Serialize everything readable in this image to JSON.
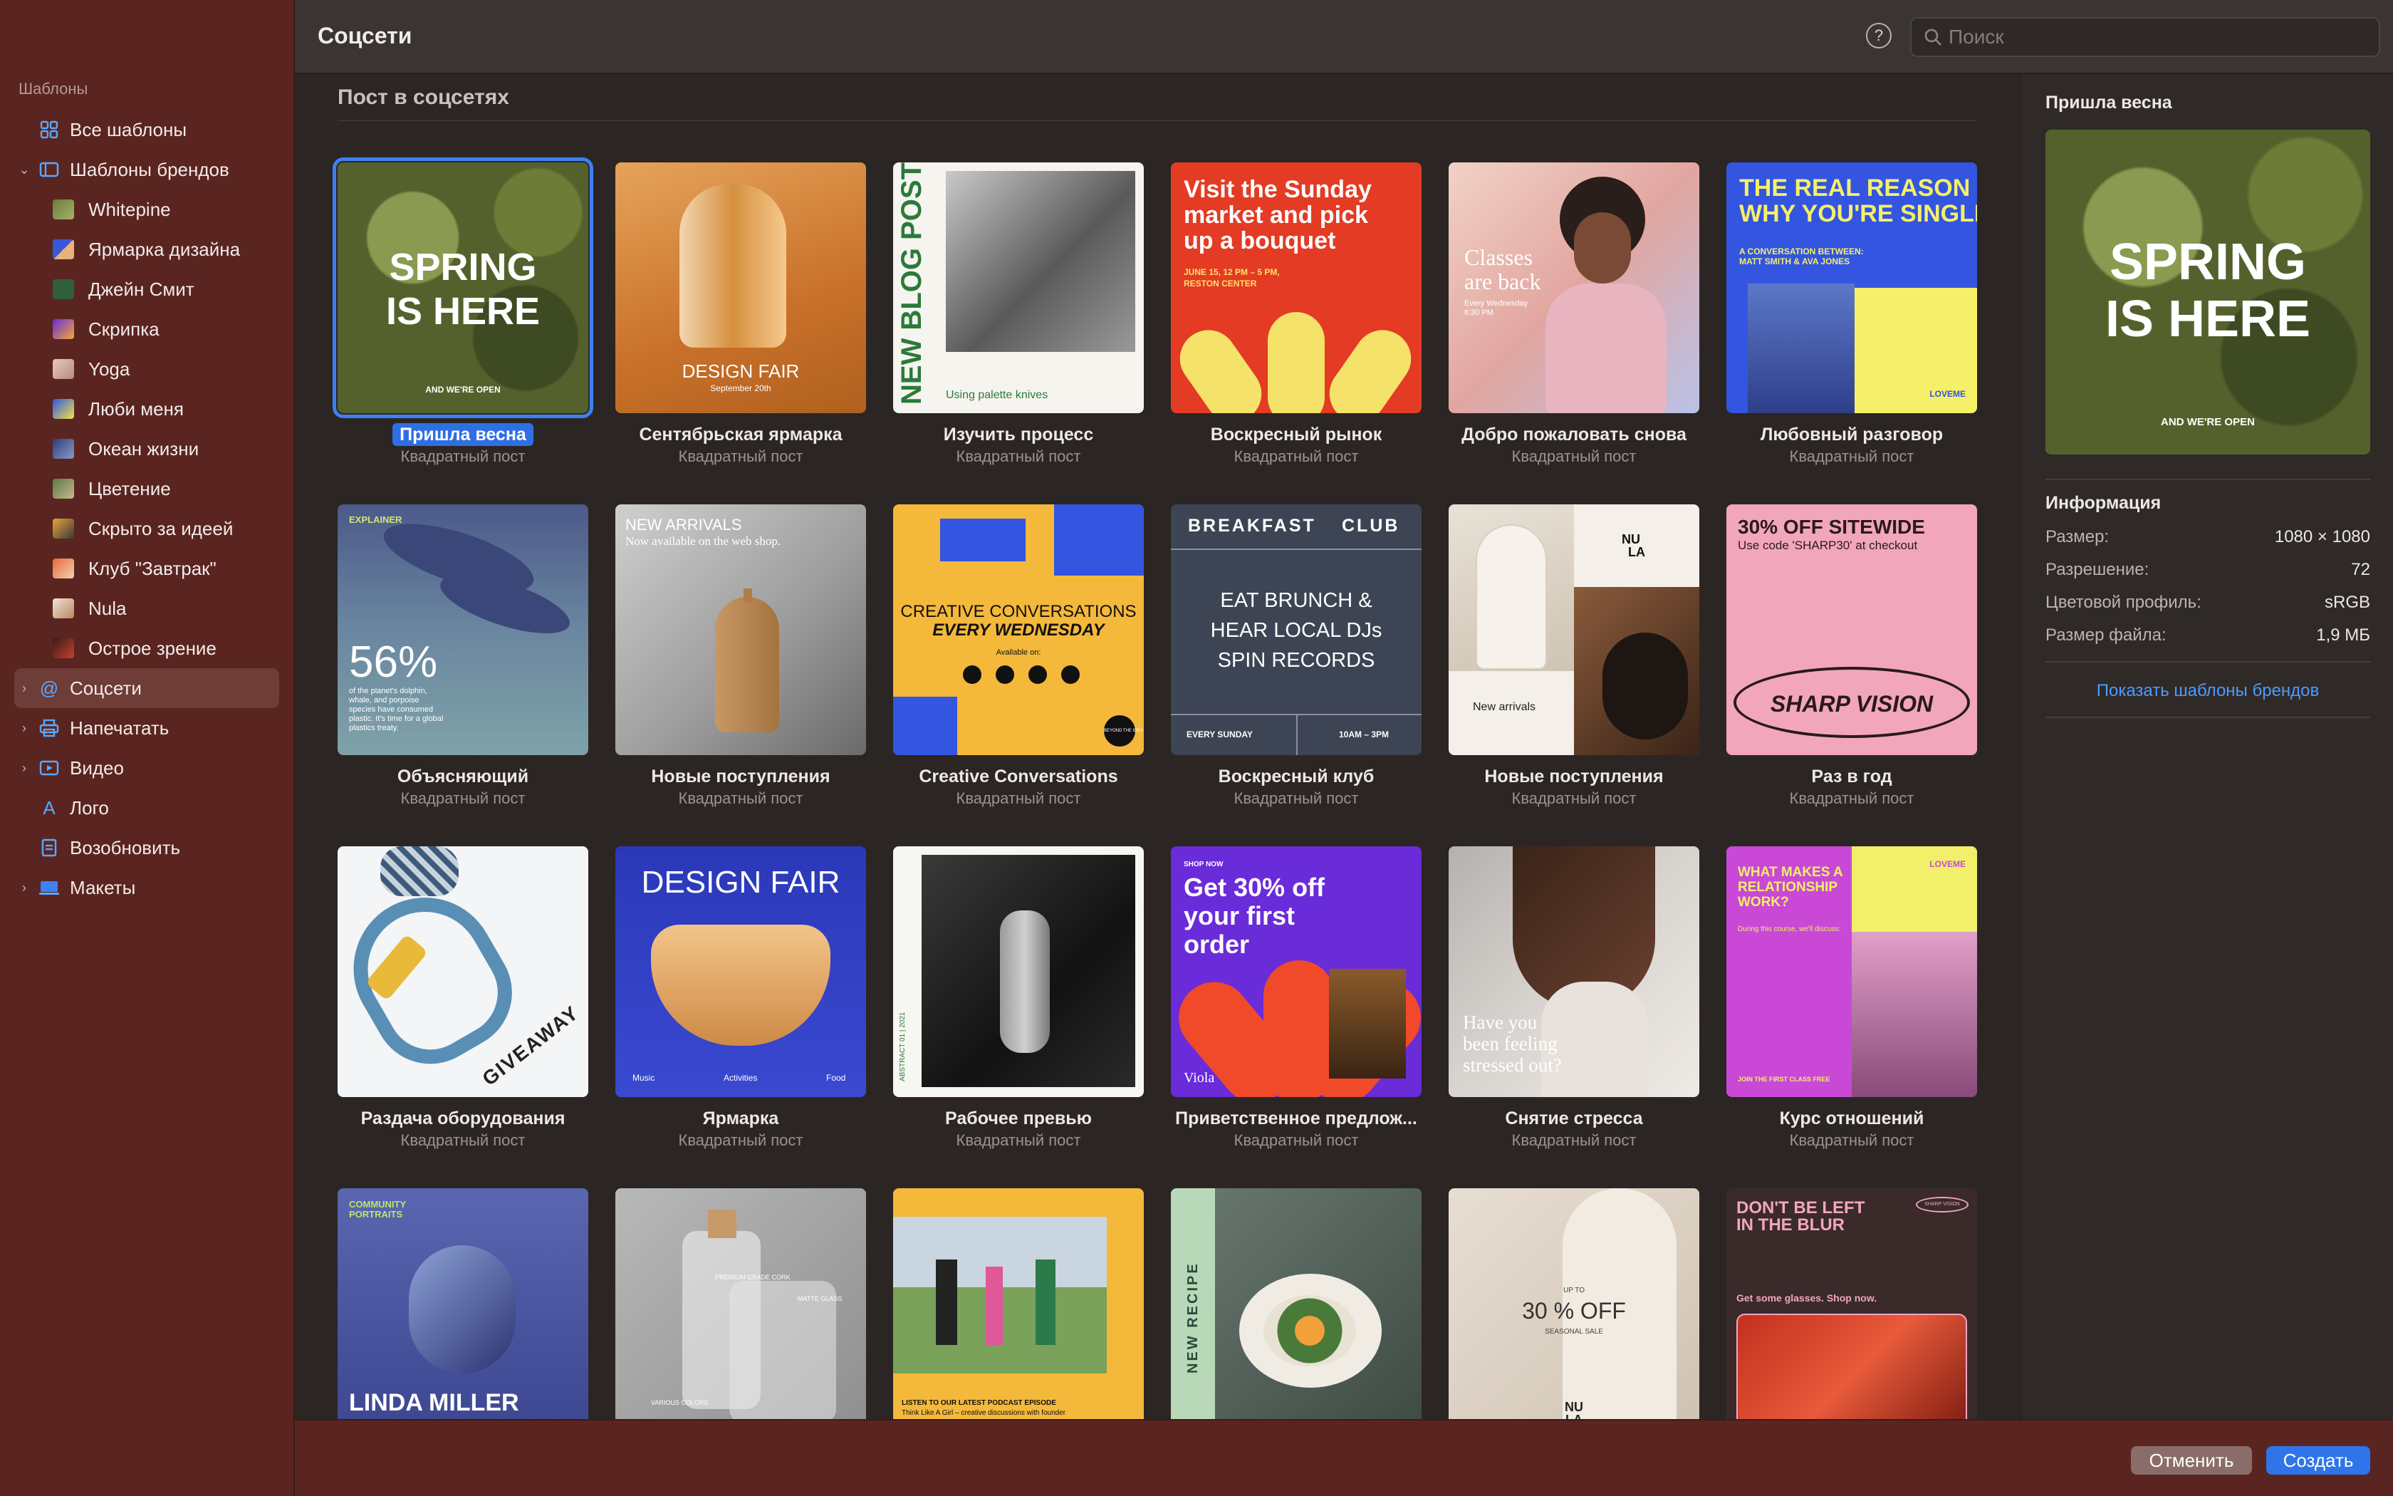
{
  "topbar": {
    "title": "Соцсети",
    "help": "?",
    "search_placeholder": "Поиск"
  },
  "sidebar": {
    "section": "Шаблоны",
    "all_templates": "Все шаблоны",
    "brand_templates": "Шаблоны брендов",
    "brands": [
      "Whitepine",
      "Ярмарка дизайна",
      "Джейн Смит",
      "Скрипка",
      "Yoga",
      "Люби меня",
      "Океан жизни",
      "Цветение",
      "Скрыто за идеей",
      "Клуб \"Завтрак\"",
      "Nula",
      "Острое зрение"
    ],
    "social": "Соцсети",
    "print": "Напечатать",
    "video": "Видео",
    "logo": "Лого",
    "resume": "Возобновить",
    "mockups": "Макеты"
  },
  "main": {
    "section_title": "Пост в соцсетях",
    "card_subtitle": "Квадратный пост",
    "cards": [
      {
        "title": "Пришла весна"
      },
      {
        "title": "Сентябрьская ярмарка"
      },
      {
        "title": "Изучить процесс"
      },
      {
        "title": "Воскресный рынок"
      },
      {
        "title": "Добро пожаловать снова"
      },
      {
        "title": "Любовный разговор"
      },
      {
        "title": "Объясняющий"
      },
      {
        "title": "Новые поступления"
      },
      {
        "title": "Creative Conversations"
      },
      {
        "title": "Воскресный клуб"
      },
      {
        "title": "Новые поступления"
      },
      {
        "title": "Раз в год"
      },
      {
        "title": "Раздача оборудования"
      },
      {
        "title": "Ярмарка"
      },
      {
        "title": "Рабочее превью"
      },
      {
        "title": "Приветственное предлож..."
      },
      {
        "title": "Снятие стресса"
      },
      {
        "title": "Курс отношений"
      }
    ],
    "thumbs": {
      "spring": [
        "SPRING",
        "IS HERE",
        "AND WE'RE OPEN"
      ],
      "fair": [
        "DESIGN FAIR",
        "September 20th"
      ],
      "blog": [
        "NEW BLOG POST",
        "Using palette knives"
      ],
      "market": [
        "Visit the Sunday",
        "market and pick",
        "up a bouquet",
        "JUNE 15, 12 PM – 5 PM,",
        "RESTON CENTER"
      ],
      "classes": [
        "Classes",
        "are back",
        "Every Wednesday",
        "6:30 PM"
      ],
      "reason": [
        "THE REAL REASON",
        "WHY YOU'RE SINGLE",
        "A CONVERSATION BETWEEN:",
        "MATT SMITH & AVA JONES",
        "LOVEME"
      ],
      "explainer": [
        "EXPLAINER",
        "56%",
        "of the planet's dolphin,",
        "whale, and porpoise",
        "species have consumed",
        "plastic. It's time for a global",
        "plastics treaty."
      ],
      "arrivals": [
        "NEW ARRIVALS",
        "Now available on the web shop."
      ],
      "creative": [
        "CREATIVE CONVERSATIONS",
        "EVERY WEDNESDAY",
        "Available on:",
        "BEYOND THE IDEA"
      ],
      "breakfast": [
        "BREAKFAST",
        "CLUB",
        "EAT BRUNCH &",
        "HEAR LOCAL DJs",
        "SPIN RECORDS",
        "EVERY SUNDAY",
        "10AM – 3PM"
      ],
      "nula": [
        "NU",
        "LA",
        "New arrivals"
      ],
      "sharp": [
        "30% OFF SITEWIDE",
        "Use code 'SHARP30' at checkout",
        "SHARP VISION"
      ],
      "giveaway": [
        "GIVEAWAY"
      ],
      "fair2": [
        "DESIGN FAIR",
        "Music",
        "Activities",
        "Food"
      ],
      "preview": [
        "ABSTRACT 01 | 2021"
      ],
      "offer": [
        "SHOP NOW",
        "Get 30% off",
        "your first",
        "order",
        "Viola"
      ],
      "stress": [
        "Have you",
        "been feeling",
        "stressed out?"
      ],
      "relation": [
        "WHAT MAKES A",
        "RELATIONSHIP",
        "WORK?",
        "LOVEME",
        "During this course, we'll discuss:",
        "JOIN THE FIRST CLASS FREE"
      ],
      "linda": [
        "COMMUNITY",
        "PORTRAITS",
        "LINDA MILLER"
      ],
      "bottle": [
        "PREMIUM GRADE CORK",
        "MATTE GLASS",
        "VARIOUS COLORS"
      ],
      "podcast": [
        "LISTEN TO OUR LATEST PODCAST EPISODE",
        "Think Like A Girl – creative discussions with founder"
      ],
      "recipe": [
        "NEW RECIPE"
      ],
      "sale": [
        "UP TO",
        "30 % OFF",
        "SEASONAL SALE",
        "NU",
        "LA"
      ],
      "blur": [
        "DON'T BE LEFT",
        "IN THE BLUR",
        "SHARP VISION",
        "Get some glasses. Shop now."
      ]
    }
  },
  "inspector": {
    "title": "Пришла весна",
    "info_heading": "Информация",
    "rows": [
      {
        "label": "Размер:",
        "value": "1080 × 1080"
      },
      {
        "label": "Разрешение:",
        "value": "72"
      },
      {
        "label": "Цветовой профиль:",
        "value": "sRGB"
      },
      {
        "label": "Размер файла:",
        "value": "1,9 МБ"
      }
    ],
    "link": "Показать шаблоны брендов"
  },
  "footer": {
    "cancel": "Отменить",
    "create": "Создать"
  }
}
